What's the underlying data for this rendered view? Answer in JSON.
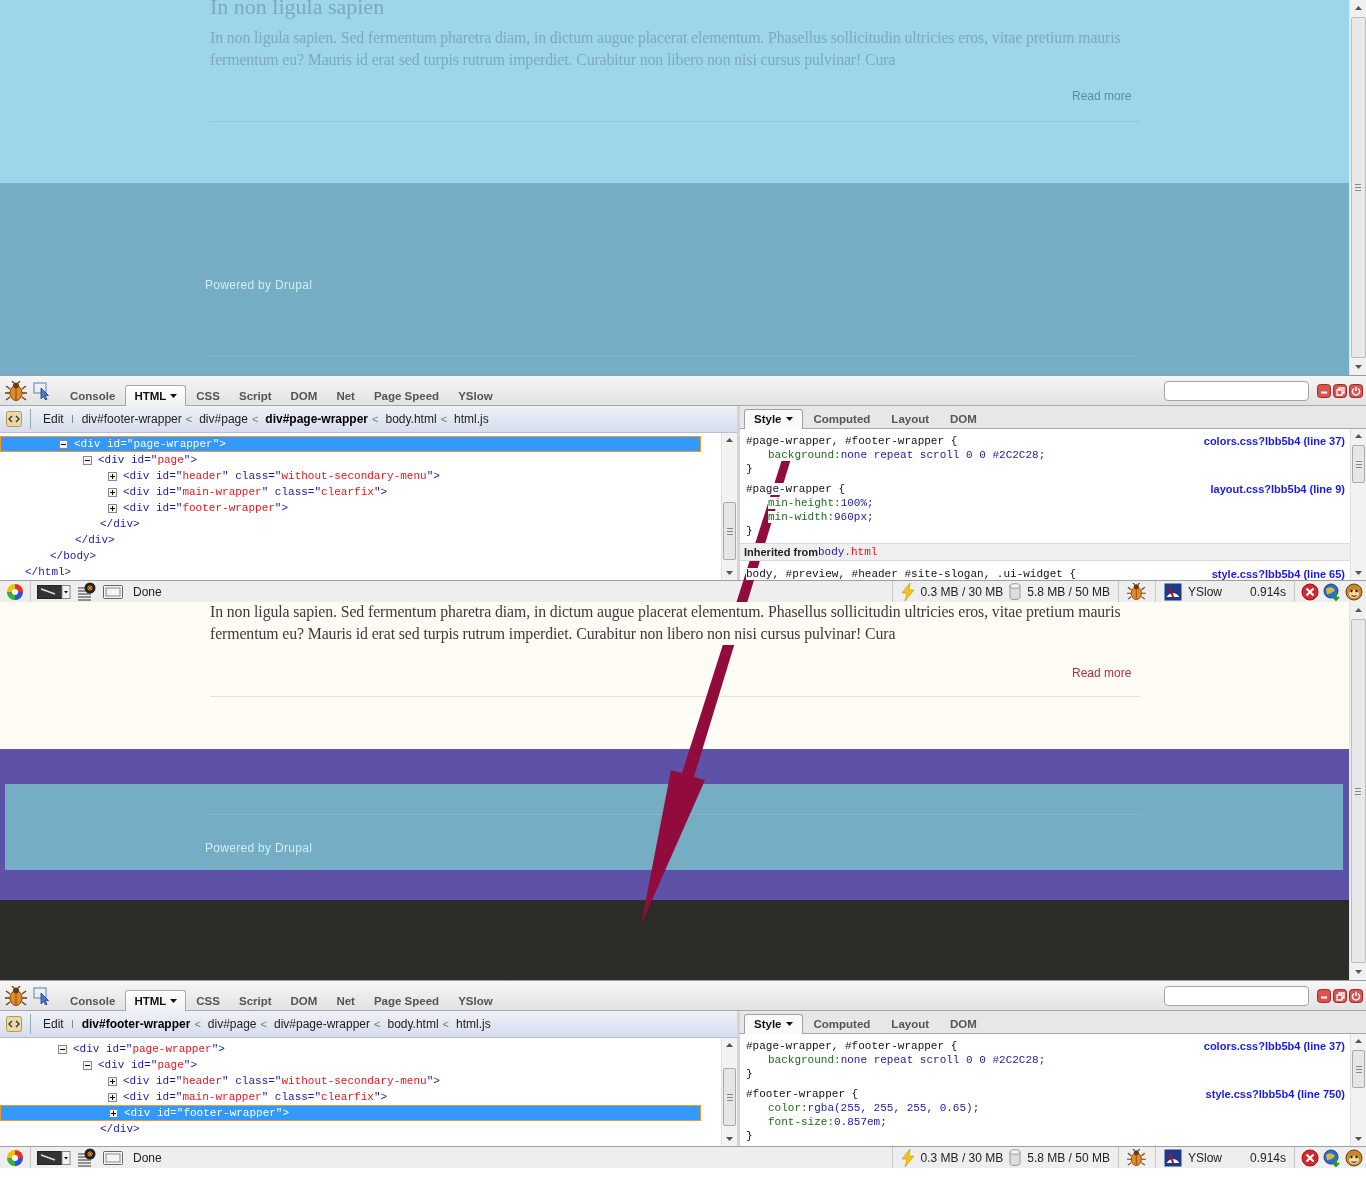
{
  "panels": [
    {
      "page": {
        "kind": "page-highlighted",
        "heading": "In non ligula sapien",
        "paragraph": "In non ligula sapien. Sed fermentum pharetra diam, in dictum augue placerat elementum. Phasellus sollicitudin ultricies eros, vitae pretium mauris fermentum eu? Mauris id erat sed turpis rutrum imperdiet. Curabitur non libero non nisi cursus pulvinar! Cura",
        "read_more": "Read more",
        "footer_text": "Powered by Drupal"
      },
      "firebug": {
        "tabs": [
          {
            "label": "Console",
            "selected": false,
            "menu": false
          },
          {
            "label": "HTML",
            "selected": true,
            "menu": true
          },
          {
            "label": "CSS",
            "selected": false,
            "menu": false
          },
          {
            "label": "Script",
            "selected": false,
            "menu": false
          },
          {
            "label": "DOM",
            "selected": false,
            "menu": false
          },
          {
            "label": "Net",
            "selected": false,
            "menu": false
          },
          {
            "label": "Page Speed",
            "selected": false,
            "menu": false
          },
          {
            "label": "YSlow",
            "selected": false,
            "menu": false
          }
        ],
        "breadcrumb": {
          "edit": "Edit",
          "items": [
            {
              "label": "div#footer-wrapper",
              "selected": false
            },
            {
              "label": "div#page",
              "selected": false
            },
            {
              "label": "div#page-wrapper",
              "selected": true
            },
            {
              "label": "body.html",
              "selected": false
            },
            {
              "label": "html.js",
              "selected": false
            }
          ],
          "separator": "<"
        },
        "tree": [
          {
            "close": "</html>",
            "children": [
              {
                "close": "</body>",
                "children": [
                  {
                    "open": [
                      {
                        "text": "<div id=\"",
                        "kind": "tag"
                      },
                      {
                        "text": "page-wrapper",
                        "kind": "value"
                      },
                      {
                        "text": "\">",
                        "kind": "tag"
                      }
                    ],
                    "expanded": true,
                    "selected": true,
                    "close": "</div>",
                    "children": [
                      {
                        "open": [
                          {
                            "text": "<div id=\"",
                            "kind": "tag"
                          },
                          {
                            "text": "page",
                            "kind": "value"
                          },
                          {
                            "text": "\">",
                            "kind": "tag"
                          }
                        ],
                        "expanded": true,
                        "selected": false,
                        "close": "</div>",
                        "children": [
                          {
                            "open": [
                              {
                                "text": "<div id=\"",
                                "kind": "tag"
                              },
                              {
                                "text": "header",
                                "kind": "value"
                              },
                              {
                                "text": "\" class=\"",
                                "kind": "tag"
                              },
                              {
                                "text": "without-secondary-menu",
                                "kind": "value"
                              },
                              {
                                "text": "\">",
                                "kind": "tag"
                              }
                            ],
                            "expanded": false,
                            "selected": false
                          },
                          {
                            "open": [
                              {
                                "text": "<div id=\"",
                                "kind": "tag"
                              },
                              {
                                "text": "main-wrapper",
                                "kind": "value"
                              },
                              {
                                "text": "\" class=\"",
                                "kind": "tag"
                              },
                              {
                                "text": "clearfix",
                                "kind": "value"
                              },
                              {
                                "text": "\">",
                                "kind": "tag"
                              }
                            ],
                            "expanded": false,
                            "selected": false
                          },
                          {
                            "open": [
                              {
                                "text": "<div id=\"",
                                "kind": "tag"
                              },
                              {
                                "text": "footer-wrapper",
                                "kind": "value"
                              },
                              {
                                "text": "\">",
                                "kind": "tag"
                              }
                            ],
                            "expanded": false,
                            "selected": false
                          }
                        ]
                      }
                    ]
                  }
                ]
              }
            ]
          }
        ],
        "side_tabs": [
          {
            "label": "Style",
            "selected": true,
            "menu": true
          },
          {
            "label": "Computed",
            "selected": false,
            "menu": false
          },
          {
            "label": "Layout",
            "selected": false,
            "menu": false
          },
          {
            "label": "DOM",
            "selected": false,
            "menu": false
          }
        ],
        "rules": [
          {
            "kind": "rule",
            "selector": "#page-wrapper, #footer-wrapper {",
            "source": "colors.css?lbb5b4 (line 37)",
            "declarations": [
              {
                "property": "background:",
                "value": "none repeat scroll 0 0 #2C2C28;"
              }
            ],
            "close": "}"
          },
          {
            "kind": "rule",
            "selector": "#page-wrapper {",
            "source": "layout.css?lbb5b4 (line 9)",
            "declarations": [
              {
                "property": "min-height:",
                "value": "100%;"
              },
              {
                "property": "min-width:",
                "value": "960px;"
              }
            ],
            "close": "}"
          },
          {
            "kind": "inherited",
            "label": "Inherited from",
            "element": "body",
            "class": ".html"
          },
          {
            "kind": "rule",
            "selector": "body, #preview, #header #site-slogan, .ui-widget {",
            "source": "style.css?lbb5b4 (line 65)"
          }
        ],
        "status": {
          "text": "Done",
          "memory": "0.3 MB / 30 MB",
          "storage": "5.8 MB / 50 MB",
          "yslow": "YSlow",
          "load_time": "0.914s"
        }
      }
    },
    {
      "page": {
        "kind": "footer-highlighted",
        "paragraph": "In non ligula sapien. Sed fermentum pharetra diam, in dictum augue placerat elementum. Phasellus sollicitudin ultricies eros, vitae pretium mauris fermentum eu? Mauris id erat sed turpis rutrum imperdiet. Curabitur non libero non nisi cursus pulvinar! Cura",
        "read_more": "Read more",
        "footer_text": "Powered by Drupal"
      },
      "firebug": {
        "tabs": [
          {
            "label": "Console",
            "selected": false,
            "menu": false
          },
          {
            "label": "HTML",
            "selected": true,
            "menu": true
          },
          {
            "label": "CSS",
            "selected": false,
            "menu": false
          },
          {
            "label": "Script",
            "selected": false,
            "menu": false
          },
          {
            "label": "DOM",
            "selected": false,
            "menu": false
          },
          {
            "label": "Net",
            "selected": false,
            "menu": false
          },
          {
            "label": "Page Speed",
            "selected": false,
            "menu": false
          },
          {
            "label": "YSlow",
            "selected": false,
            "menu": false
          }
        ],
        "breadcrumb": {
          "edit": "Edit",
          "items": [
            {
              "label": "div#footer-wrapper",
              "selected": true
            },
            {
              "label": "div#page",
              "selected": false
            },
            {
              "label": "div#page-wrapper",
              "selected": false
            },
            {
              "label": "body.html",
              "selected": false
            },
            {
              "label": "html.js",
              "selected": false
            }
          ],
          "separator": "<"
        },
        "tree": [
          {
            "children": [
              {
                "children": [
                  {
                    "open": [
                      {
                        "text": "<div id=\"",
                        "kind": "tag"
                      },
                      {
                        "text": "page-wrapper",
                        "kind": "value"
                      },
                      {
                        "text": "\">",
                        "kind": "tag"
                      }
                    ],
                    "expanded": true,
                    "selected": false,
                    "children": [
                      {
                        "open": [
                          {
                            "text": "<div id=\"",
                            "kind": "tag"
                          },
                          {
                            "text": "page",
                            "kind": "value"
                          },
                          {
                            "text": "\">",
                            "kind": "tag"
                          }
                        ],
                        "expanded": true,
                        "selected": false,
                        "close": "</div>",
                        "children": [
                          {
                            "open": [
                              {
                                "text": "<div id=\"",
                                "kind": "tag"
                              },
                              {
                                "text": "header",
                                "kind": "value"
                              },
                              {
                                "text": "\" class=\"",
                                "kind": "tag"
                              },
                              {
                                "text": "without-secondary-menu",
                                "kind": "value"
                              },
                              {
                                "text": "\">",
                                "kind": "tag"
                              }
                            ],
                            "expanded": false,
                            "selected": false
                          },
                          {
                            "open": [
                              {
                                "text": "<div id=\"",
                                "kind": "tag"
                              },
                              {
                                "text": "main-wrapper",
                                "kind": "value"
                              },
                              {
                                "text": "\" class=\"",
                                "kind": "tag"
                              },
                              {
                                "text": "clearfix",
                                "kind": "value"
                              },
                              {
                                "text": "\">",
                                "kind": "tag"
                              }
                            ],
                            "expanded": false,
                            "selected": false
                          },
                          {
                            "open": [
                              {
                                "text": "<div id=\"",
                                "kind": "tag"
                              },
                              {
                                "text": "footer-wrapper",
                                "kind": "value"
                              },
                              {
                                "text": "\">",
                                "kind": "tag"
                              }
                            ],
                            "expanded": false,
                            "selected": true
                          }
                        ]
                      }
                    ]
                  }
                ]
              }
            ]
          }
        ],
        "side_tabs": [
          {
            "label": "Style",
            "selected": true,
            "menu": true
          },
          {
            "label": "Computed",
            "selected": false,
            "menu": false
          },
          {
            "label": "Layout",
            "selected": false,
            "menu": false
          },
          {
            "label": "DOM",
            "selected": false,
            "menu": false
          }
        ],
        "rules": [
          {
            "kind": "rule",
            "selector": "#page-wrapper, #footer-wrapper {",
            "source": "colors.css?lbb5b4 (line 37)",
            "declarations": [
              {
                "property": "background:",
                "value": "none repeat scroll 0 0 #2C2C28;"
              }
            ],
            "close": "}"
          },
          {
            "kind": "rule",
            "selector": "#footer-wrapper {",
            "source": "style.css?lbb5b4 (line 750)",
            "declarations": [
              {
                "property": "color:",
                "value": "rgba(255, 255, 255, 0.65);"
              },
              {
                "property": "font-size:",
                "value": "0.857em;"
              }
            ],
            "close": "}"
          }
        ],
        "status": {
          "text": "Done",
          "memory": "0.3 MB / 30 MB",
          "storage": "5.8 MB / 50 MB",
          "yslow": "YSlow",
          "load_time": "0.914s"
        }
      }
    }
  ],
  "annotation": {
    "kind": "arrow"
  }
}
